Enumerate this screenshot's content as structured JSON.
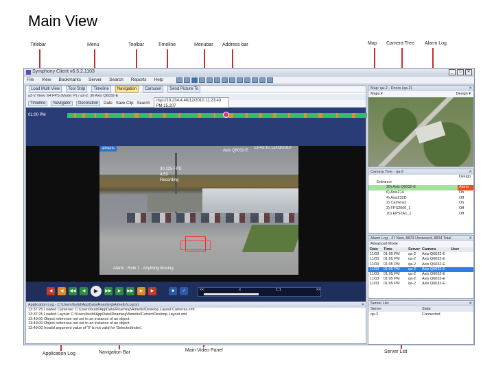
{
  "slide": {
    "title": "Main View"
  },
  "callouts": {
    "titlebar": "Titlebar",
    "menu": "Menu",
    "toolbar": "Toolbar",
    "timeline": "Timeline",
    "menubar": "Menubar",
    "address_bar": "Address bar",
    "map": "Map",
    "camera_tree": "Camera Tree",
    "alarm_log": "Alarm Log",
    "application_log": "Application Log",
    "navigation_bar": "Navigation Bar",
    "main_video_panel": "Main Video Panel",
    "server_list": "Server List"
  },
  "app": {
    "title": "Symphony Client v6.5.2.1103",
    "window_buttons": [
      "_",
      "□",
      "✕"
    ],
    "menu": [
      "File",
      "View",
      "Bookmarks",
      "Server",
      "Search",
      "Reports",
      "Help"
    ],
    "toolbar": {
      "layout": "Load Multi View",
      "tool_strip": "Tool Strip",
      "timeline": "Timeline",
      "navigation": "Navigation",
      "carousel": "Carousel",
      "send_picture": "Send Picture To"
    },
    "panel_header": "a2-2 View: 64 FPS (Mode: P) / a2-2: 30 Axis Q6032-E",
    "toolbar2": {
      "timeline": "Timeline",
      "navigator": "Navigator",
      "decoration": "Decoration",
      "date": "Date",
      "save_clip": "Save Clip",
      "search": "Search",
      "address": "rtsp://10.234.4.40/12/2010 11:23:43 PM 15.207"
    },
    "timeline_time": "01:00 PM",
    "video": {
      "logo": "aimetis",
      "camera": "Axis Q6032-E",
      "datetime": "13:43:15 11/03/2010",
      "fps": "30.125 FPS",
      "bitrate": "4.53",
      "recording": "Recording",
      "alarm": "Alarm - Rule 1 - Anything Moving"
    },
    "navbar": {
      "buttons": [
        "◀",
        "◀",
        "◀◀",
        "◀",
        "▶",
        "▶▶",
        "▶",
        "▶▶",
        "▶",
        "▶",
        "■",
        "✓"
      ],
      "speed_labels": [
        "<<",
        "x",
        "1:1",
        ">>"
      ]
    },
    "app_log": {
      "title": "Application Log - C:\\Users\\build\\AppData\\Roaming\\Aimetis\\Log.txt",
      "lines": [
        "13:37:25 Loaded Camerax: C:\\Users\\build\\AppData\\Roaming\\Aimetis\\Desktop.Layout.Cameras.xml",
        "13:37:25 Loaded Layout: C:\\Users\\build\\AppData\\Roaming\\Aimetis\\CurrentDesktop.Layout.xml",
        "13:49:00 Object reference not set to an instance of an object.",
        "13:49:00 Object reference not set to an instance of an object.",
        "13:49:00 Invalid argument value of '0' is not valid for 'SelectedIndex'."
      ]
    },
    "map": {
      "header": "Map: qa-2 - Doors (qa-2)",
      "toolbar": "Maps ▾",
      "design": "Design ▾"
    },
    "camera_tree": {
      "header": "Camera Tree - qa-2",
      "design": "Design",
      "root": "Entrance",
      "rows": [
        {
          "name": "30) Axis Q6032-E",
          "status": "Alarm"
        },
        {
          "name": "6) Axis214",
          "status": "On"
        },
        {
          "name": "4) Axis232D",
          "status": "Off"
        },
        {
          "name": "2) Camera2",
          "status": "On"
        },
        {
          "name": "3) FPS2000_1",
          "status": "Off"
        },
        {
          "name": "10) EPS1A1_1",
          "status": "Off"
        }
      ]
    },
    "alarm_log": {
      "header": "Alarm Log - 47 New, 8879 Unviewed, 8834 Total",
      "advanced": "Advanced Mode",
      "columns": [
        "Date",
        "Time",
        "Server",
        "Camera",
        "User"
      ],
      "rows": [
        [
          "11/03",
          "01:05 PM",
          "qa-2",
          "Axis Q6032-E",
          ""
        ],
        [
          "11/03",
          "01:05 PM",
          "qa-2",
          "Axis Q6032-E",
          ""
        ],
        [
          "11/03",
          "01:05 PM",
          "qa-2",
          "Axis Q6032-E",
          ""
        ],
        [
          "11/03",
          "01:05 PM",
          "qa-2",
          "Axis Q6032-E",
          ""
        ],
        [
          "11/03",
          "01:05 PM",
          "qa-2",
          "Axis Q6032-E",
          ""
        ],
        [
          "11/03",
          "01:05 PM",
          "qa-2",
          "Axis Q6032-E",
          ""
        ],
        [
          "11/03",
          "01:05 PM",
          "qa-2",
          "Axis Q6032-E",
          ""
        ]
      ]
    },
    "server_list": {
      "header": "Server List",
      "columns": [
        "Server",
        "State"
      ],
      "rows": [
        [
          "qa-2",
          "Connected"
        ]
      ]
    }
  }
}
